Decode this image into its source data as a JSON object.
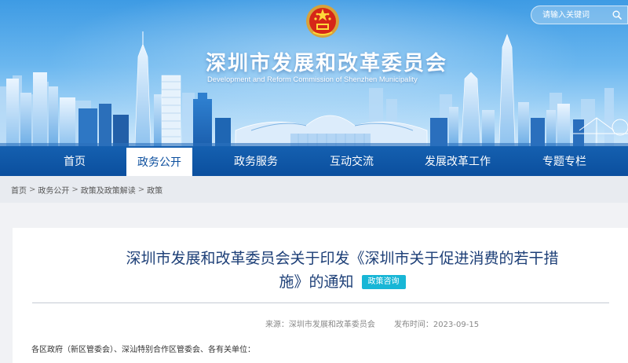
{
  "header": {
    "title": "深圳市发展和改革委员会",
    "subtitle": "Development and Reform Commission of Shenzhen Municipality",
    "emblem_icon": "national-emblem-icon",
    "search": {
      "placeholder": "请输入关键词",
      "icon": "search-icon"
    }
  },
  "nav": {
    "items": [
      {
        "label": "首页",
        "active": false
      },
      {
        "label": "政务公开",
        "active": true
      },
      {
        "label": "政务服务",
        "active": false
      },
      {
        "label": "互动交流",
        "active": false
      },
      {
        "label": "发展改革工作",
        "active": false
      },
      {
        "label": "专题专栏",
        "active": false
      }
    ]
  },
  "breadcrumb": {
    "items": [
      "首页",
      "政务公开",
      "政策及政策解读",
      "政策"
    ],
    "separator": ">"
  },
  "article": {
    "title_line1": "深圳市发展和改革委员会关于印发《深圳市关于促进消费的若干措",
    "title_line2": "施》的通知",
    "tag": "政策咨询",
    "source_label": "来源：深圳市发展和改革委员会",
    "date_label": "发布时间：2023-09-15",
    "salutation": "各区政府（新区管委会）、深汕特别合作区管委会、各有关单位："
  },
  "colors": {
    "nav_bg": "#0b4f9e",
    "title": "#1d3f77",
    "tag_bg": "#18b6d6",
    "page_bg": "#f1f2f5"
  }
}
